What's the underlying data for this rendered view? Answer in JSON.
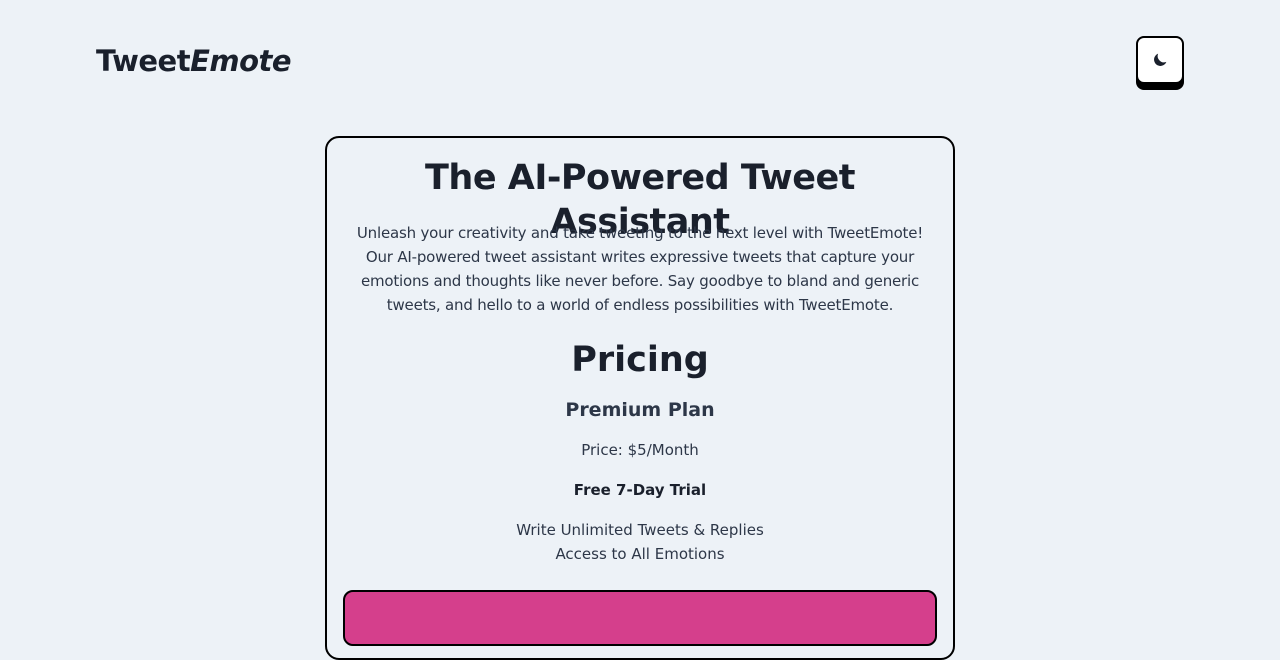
{
  "header": {
    "logo_main": "Tweet",
    "logo_accent": "Emote",
    "theme_toggle_icon": "moon-icon"
  },
  "hero": {
    "title": "The AI-Powered Tweet Assistant",
    "description": "Unleash your creativity and take tweeting to the next level with TweetEmote! Our AI-powered tweet assistant writes expressive tweets that capture your emotions and thoughts like never before. Say goodbye to bland and generic tweets, and hello to a world of endless possibilities with TweetEmote."
  },
  "pricing": {
    "heading": "Pricing",
    "plan_name": "Premium Plan",
    "price": "Price: $5/Month",
    "trial": "Free 7-Day Trial",
    "features": [
      "Write Unlimited Tweets & Replies",
      "Access to All Emotions"
    ]
  },
  "colors": {
    "background": "#edf2f7",
    "text": "#1a202c",
    "accent": "#d53f8c",
    "border": "#000000"
  }
}
